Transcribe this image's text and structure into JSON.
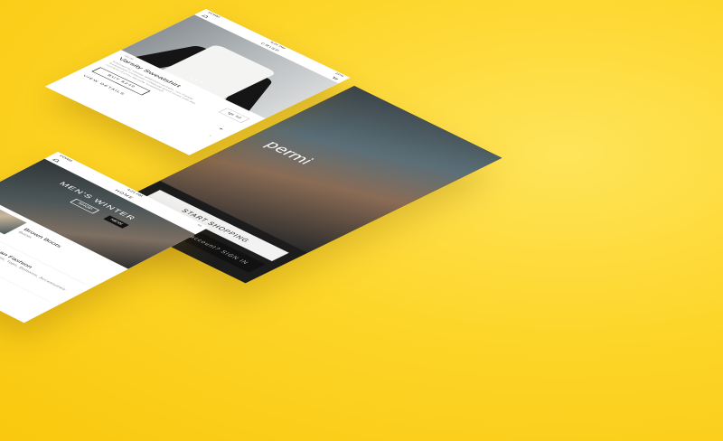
{
  "back_screen": {
    "brand_text": "permi",
    "start_button": "START SHOPPING",
    "signin_button": "Already have an account? SIGN IN"
  },
  "home_screen": {
    "status": {
      "carrier": "FORM",
      "time": "4:21 PM"
    },
    "nav_title": "HOME",
    "hero_title": "MEN'S WINTER",
    "tab_shop": "SHOP",
    "tab_new": "NEW",
    "cards": [
      {
        "title": "Brown Boots",
        "subtitle": "Boots"
      },
      {
        "title": "Urban Fashion",
        "subtitle": "Sweaters, Tops, Bottoms, Accessories",
        "logo": "U"
      }
    ]
  },
  "product_screen": {
    "status": {
      "carrier": "FORM",
      "time": "4:21 PM",
      "battery": "22%"
    },
    "nav_title": "CRISP",
    "sku": "0076",
    "product_title": "Varsity Sweatshirt",
    "product_desc": "Inspired by varsity letterman jackets, our Varsity Sweatshirt combines collegiate good looks with the comfort of your favorite sweatshirt.",
    "like_count": "52",
    "buy_label": "BUY $249",
    "details_label": "VIEW DETAILS",
    "plus_icon": "+"
  },
  "colors": {
    "background": "#fdd62a"
  }
}
